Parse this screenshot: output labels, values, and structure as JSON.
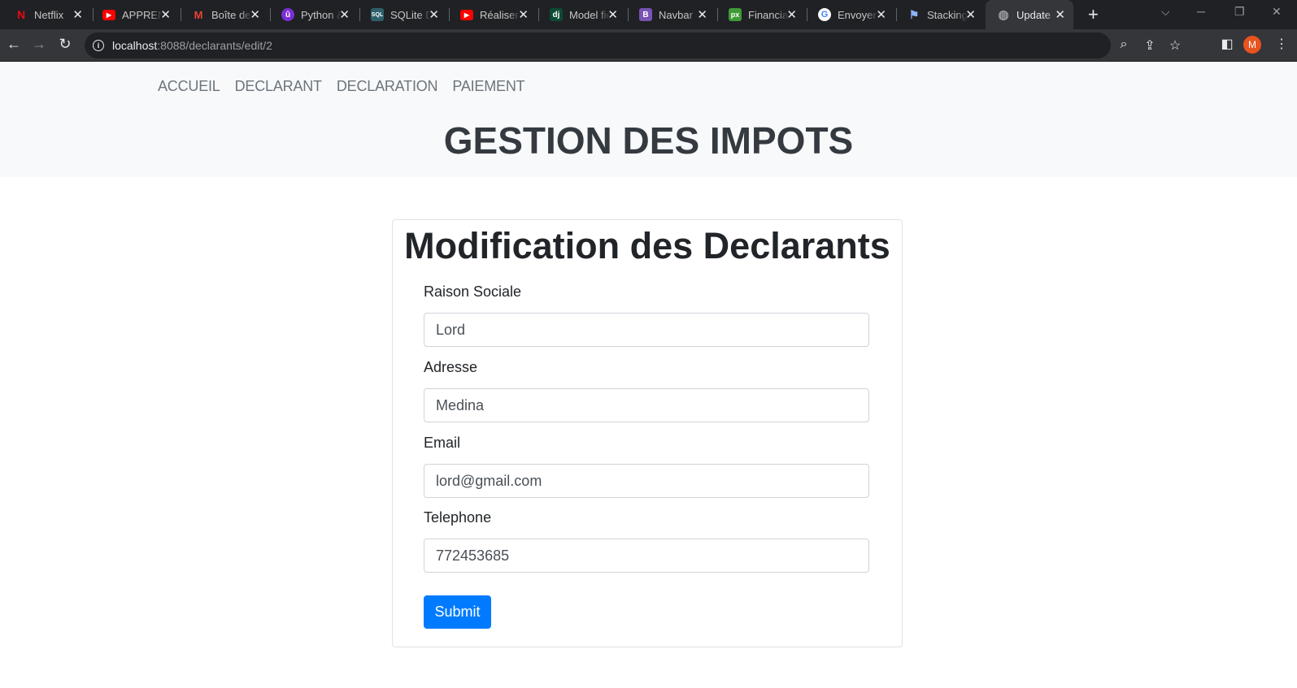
{
  "browser": {
    "tabs": [
      {
        "title": "Netflix",
        "icon": "netflix-icon",
        "icon_glyph": "N",
        "icon_color": "#e50914",
        "active": false
      },
      {
        "title": "APPRENDRE",
        "icon": "youtube-icon",
        "icon_glyph": "▶",
        "icon_color": "#ff0000",
        "active": false
      },
      {
        "title": "Boîte de réception",
        "icon": "gmail-icon",
        "icon_glyph": "M",
        "icon_color": "#ea4335",
        "active": false
      },
      {
        "title": "Python &",
        "icon": "python-course-icon",
        "icon_glyph": "û",
        "icon_color": "#7b2fd6",
        "active": false
      },
      {
        "title": "SQLite Database",
        "icon": "sqlite-icon",
        "icon_glyph": "SQL",
        "icon_color": "#2e5f6b",
        "active": false
      },
      {
        "title": "Réaliser",
        "icon": "youtube-icon",
        "icon_glyph": "▶",
        "icon_color": "#ff0000",
        "active": false
      },
      {
        "title": "Model field",
        "icon": "django-icon",
        "icon_glyph": "dj",
        "icon_color": "#0c4b33",
        "active": false
      },
      {
        "title": "Navbar",
        "icon": "bootstrap-icon",
        "icon_glyph": "B",
        "icon_color": "#7952b3",
        "active": false
      },
      {
        "title": "Financial",
        "icon": "px-icon",
        "icon_glyph": "px",
        "icon_color": "#3f9b35",
        "active": false
      },
      {
        "title": "Envoyer",
        "icon": "google-icon",
        "icon_glyph": "G",
        "icon_color": "#4285f4",
        "active": false
      },
      {
        "title": "Stacking",
        "icon": "flag-icon",
        "icon_glyph": "⚑",
        "icon_color": "#8ab4f8",
        "active": false
      },
      {
        "title": "Update",
        "icon": "globe-icon",
        "icon_glyph": "◍",
        "icon_color": "#9aa0a6",
        "active": true
      }
    ],
    "url_host": "localhost",
    "url_path": ":8088/declarants/edit/2",
    "profile_initial": "M",
    "profile_color": "#e8531f"
  },
  "navbar": {
    "links": [
      "ACCUEIL",
      "DECLARANT",
      "DECLARATION",
      "PAIEMENT"
    ],
    "title": "GESTION DES IMPOTS"
  },
  "form": {
    "title": "Modification des Declarants",
    "fields": [
      {
        "label": "Raison Sociale",
        "value": "Lord"
      },
      {
        "label": "Adresse",
        "value": "Medina"
      },
      {
        "label": "Email",
        "value": "lord@gmail.com"
      },
      {
        "label": "Telephone",
        "value": "772453685"
      }
    ],
    "submit_label": "Submit",
    "accent_color": "#007bff"
  }
}
